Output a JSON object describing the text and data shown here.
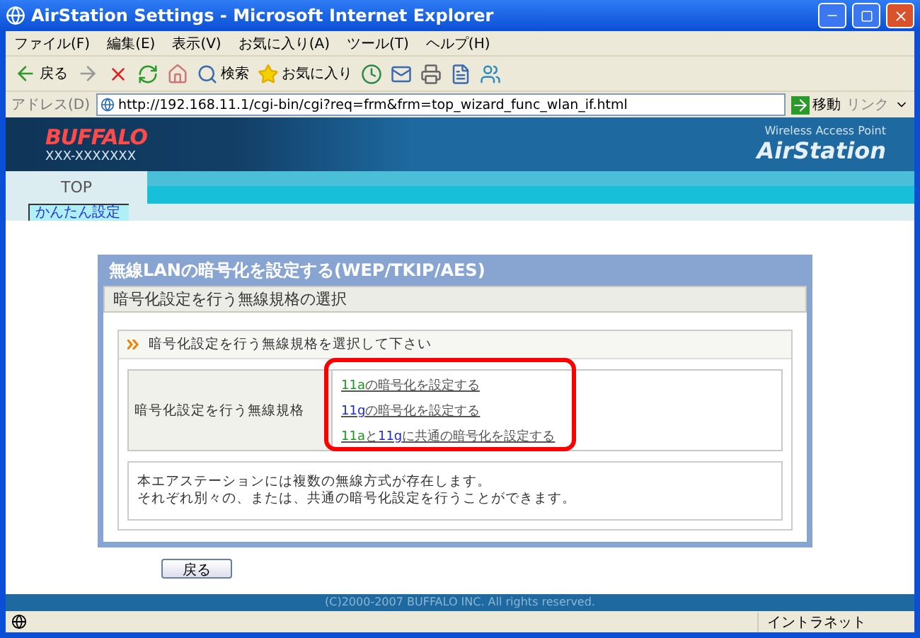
{
  "window": {
    "title": "AirStation Settings - Microsoft Internet Explorer"
  },
  "menu": [
    "ファイル(F)",
    "編集(E)",
    "表示(V)",
    "お気に入り(A)",
    "ツール(T)",
    "ヘルプ(H)"
  ],
  "toolbar": {
    "back": "戻る",
    "search": "検索",
    "favorites": "お気に入り"
  },
  "address_bar": {
    "label": "アドレス(D)",
    "url": "http://192.168.11.1/cgi-bin/cgi?req=frm&frm=top_wizard_func_wlan_if.html",
    "go": "移動",
    "links": "リンク"
  },
  "header": {
    "logo": "BUFFALO",
    "model": "XXX-XXXXXXX",
    "tagline": "Wireless Access Point",
    "product": "AirStation"
  },
  "tabs": [
    {
      "label": "TOP",
      "selected": true
    }
  ],
  "subnav": [
    {
      "label": "かんたん設定",
      "selected": true
    }
  ],
  "panel": {
    "title": "無線LANの暗号化を設定する(WEP/TKIP/AES)",
    "subtitle": "暗号化設定を行う無線規格の選択",
    "instruction": "暗号化設定を行う無線規格を選択して下さい",
    "row_label": "暗号化設定を行う無線規格",
    "highlighted": true,
    "links": [
      {
        "parts": [
          {
            "text": "11a",
            "kind": "band_a"
          },
          {
            "text": "の暗号化を設定する",
            "kind": "plain"
          }
        ]
      },
      {
        "parts": [
          {
            "text": "11g",
            "kind": "band_g"
          },
          {
            "text": "の暗号化を設定する",
            "kind": "plain"
          }
        ]
      },
      {
        "parts": [
          {
            "text": "11a",
            "kind": "band_a"
          },
          {
            "text": "と",
            "kind": "plain"
          },
          {
            "text": "11g",
            "kind": "band_g"
          },
          {
            "text": "に共通の暗号化を設定する",
            "kind": "plain"
          }
        ]
      }
    ],
    "note": [
      "本エアステーションには複数の無線方式が存在します。",
      "それぞれ別々の、または、共通の暗号化設定を行うことができます。"
    ]
  },
  "back_button": "戻る",
  "footer": "(C)2000-2007 BUFFALO INC. All rights reserved.",
  "status_bar": {
    "zone": "イントラネット"
  }
}
